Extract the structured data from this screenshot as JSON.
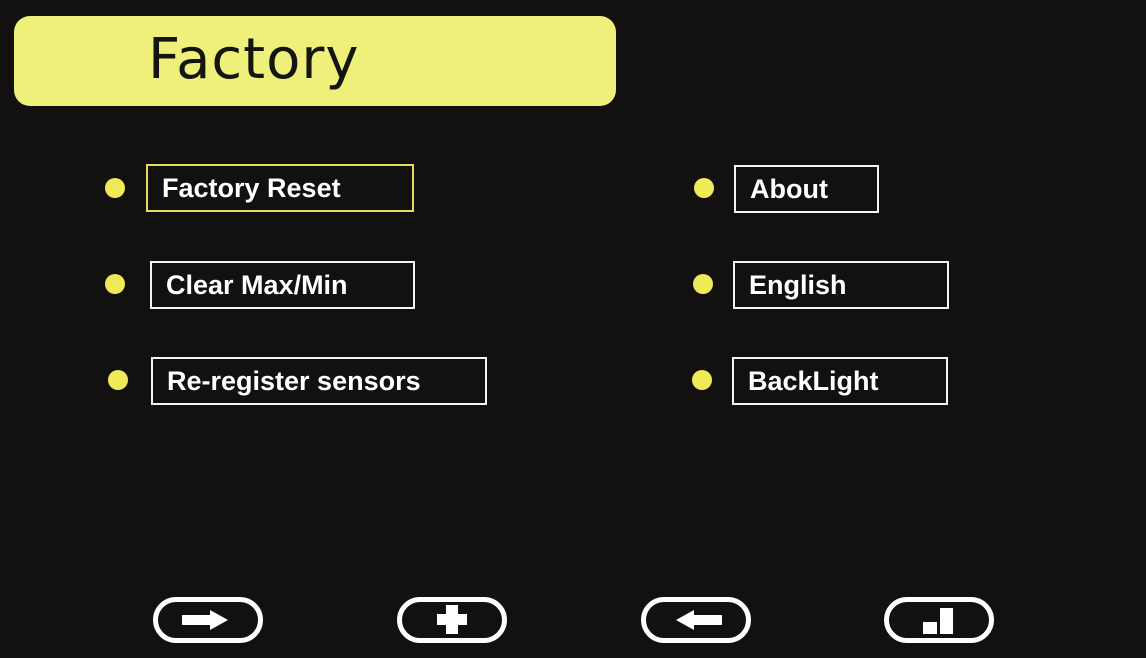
{
  "screen": {
    "title": "Factory"
  },
  "menu": {
    "left": [
      {
        "label": "Factory Reset",
        "selected": true
      },
      {
        "label": "Clear Max/Min",
        "selected": false
      },
      {
        "label": "Re-register sensors",
        "selected": false
      }
    ],
    "right": [
      {
        "label": "About",
        "selected": false
      },
      {
        "label": "English",
        "selected": false
      },
      {
        "label": "BackLight",
        "selected": false
      }
    ]
  },
  "nav_buttons": [
    {
      "icon": "arrow-right-icon"
    },
    {
      "icon": "plus-icon"
    },
    {
      "icon": "arrow-left-icon"
    },
    {
      "icon": "split-square-icon"
    }
  ],
  "colors": {
    "background": "#121110",
    "title_bar": "#eef07a",
    "bullet": "#eeea58",
    "selected_border": "#e8d860",
    "text": "#ffffff"
  }
}
